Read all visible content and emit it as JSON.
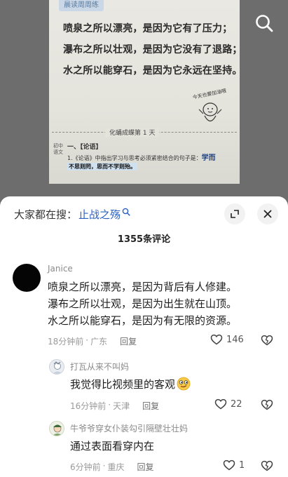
{
  "video": {
    "page_tag": "晨读周周练",
    "quote_lines": [
      "喷泉之所以漂亮，是因为它有了压力；",
      "瀑布之所以壮观，是因为它没有了退路；",
      "水之所以能穿石，是因为它永远在坚持。"
    ],
    "doodle_caption": "今天也要加油哦",
    "day_label": "化蛹成蝶第 1 天",
    "lesson_side": "初中语文",
    "lesson_head": "一、【论语】",
    "lesson_text": "1.《论语》中指出学习与思考必须紧密结合的句子是：",
    "lesson_answer": "学而",
    "lesson_highlight": "不思则罔，思而不学则殆。",
    "search_icon": "search-icon"
  },
  "sheet": {
    "search_prefix": "大家都在搜：",
    "search_term": "止战之殇",
    "comment_count": "1355条评论",
    "expand_icon": "expand-icon",
    "close_icon": "close-icon"
  },
  "comments": [
    {
      "user": "Janice",
      "lines": [
        "喷泉之所以漂亮，是因为背后有人修建。",
        "瀑布之所以壮观，是因为出生就在山顶。",
        "水之所以能穿石，是因为有无限的资源。"
      ],
      "time": "18分钟前",
      "location": "广东",
      "reply": "回复",
      "likes": "146"
    },
    {
      "user": "打瓦从来不叫妈",
      "lines": [
        "我觉得比视频里的客观"
      ],
      "time": "16分钟前",
      "location": "天津",
      "reply": "回复",
      "likes": "22"
    },
    {
      "user": "牛爷爷穿女仆装勾引隔壁壮壮妈",
      "lines": [
        "通过表面看穿内在"
      ],
      "time": "6分钟前",
      "location": "重庆",
      "reply": "回复",
      "likes": "1"
    }
  ],
  "colors": {
    "link": "#2b5fbf",
    "meta": "#9a9a9a",
    "sheet_bg": "#ffffff",
    "backdrop": "#6f6f6f"
  }
}
